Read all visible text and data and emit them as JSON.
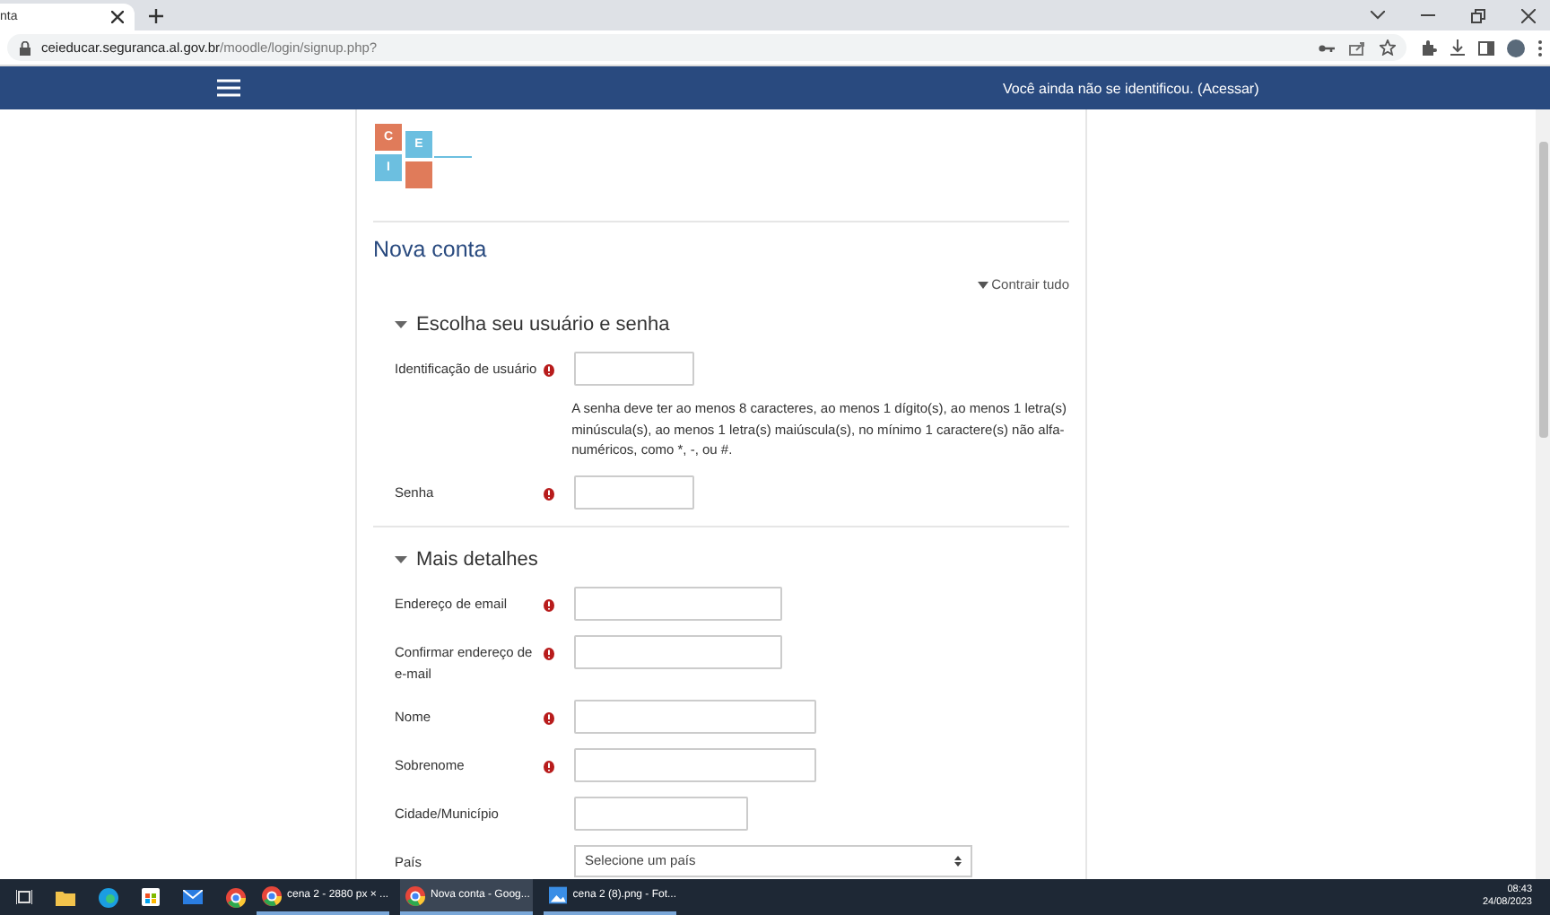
{
  "browser": {
    "tab_title": "nta",
    "url_host": "ceieducar.seguranca.al.gov.br",
    "url_path": "/moodle/login/signup.php?"
  },
  "navbar": {
    "login_text": "Você ainda não se identificou. (Acessar)"
  },
  "logo": {
    "letters": [
      "C",
      "E",
      "I"
    ]
  },
  "page_title": "Nova conta",
  "collapse_all": "Contrair tudo",
  "sections": [
    {
      "title": "Escolha seu usuário e senha",
      "expanded": true,
      "fields": [
        {
          "kind": "text",
          "label": "Identificação de usuário",
          "required": true
        },
        {
          "kind": "note",
          "text": "A senha deve ter ao menos 8 caracteres, ao menos 1 dígito(s), ao menos 1 letra(s) minúscula(s), ao menos 1 letra(s) maiúscula(s), no mínimo 1 caractere(s) não alfa-numéricos, como *, -, ou #."
        },
        {
          "kind": "text",
          "label": "Senha",
          "required": true
        }
      ]
    },
    {
      "title": "Mais detalhes",
      "expanded": true,
      "fields": [
        {
          "kind": "text",
          "label": "Endereço de email",
          "required": true
        },
        {
          "kind": "text",
          "label": "Confirmar endereço de e-mail",
          "required": true
        },
        {
          "kind": "text",
          "label": "Nome",
          "required": true
        },
        {
          "kind": "text",
          "label": "Sobrenome",
          "required": true
        },
        {
          "kind": "text",
          "label": "Cidade/Município",
          "required": false
        },
        {
          "kind": "select",
          "label": "País",
          "value": "Selecione um país"
        }
      ]
    }
  ],
  "taskbar": {
    "items": [
      {
        "label": "cena 2 - 2880 px × ...",
        "kind": "chrome",
        "selected": false
      },
      {
        "label": "Nova conta - Goog...",
        "kind": "chrome",
        "selected": true
      },
      {
        "label": "cena 2 (8).png - Fot...",
        "kind": "photos",
        "selected": false
      }
    ],
    "time": "08:43",
    "date": "24/08/2023"
  }
}
